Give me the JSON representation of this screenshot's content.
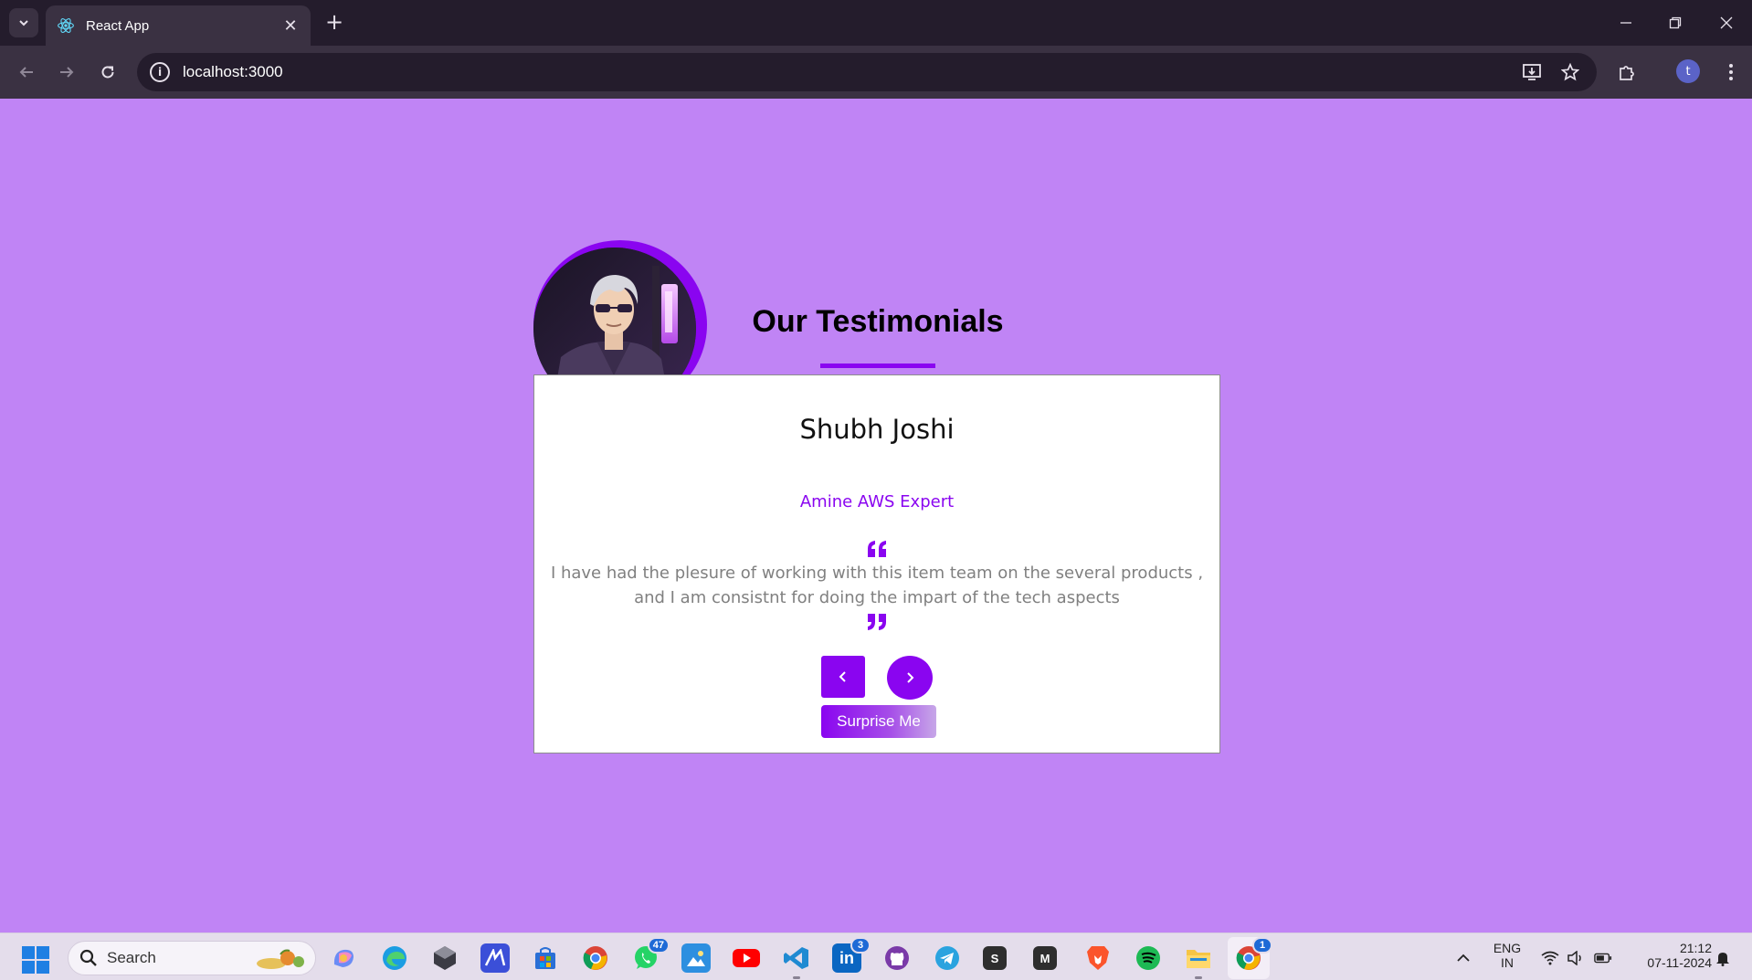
{
  "browser": {
    "tab_title": "React App",
    "url": "localhost:3000",
    "profile_initial": "t"
  },
  "page": {
    "heading": "Our Testimonials",
    "accent_color": "#8a05f0",
    "background_color": "#c084f5",
    "testimonial": {
      "name": "Shubh Joshi",
      "role": "Amine AWS Expert",
      "text": "I have had the plesure of working with this item team on the several products , and I am consistnt for doing the impart of the tech aspects"
    },
    "buttons": {
      "prev_icon": "chevron-left-icon",
      "next_icon": "chevron-right-icon",
      "surprise_label": "Surprise Me"
    }
  },
  "taskbar": {
    "search_label": "Search",
    "badges": {
      "whatsapp": "47",
      "linkedin": "3",
      "chrome": "1"
    },
    "language_line1": "ENG",
    "language_line2": "IN",
    "time": "21:12",
    "date": "07-11-2024",
    "apps": [
      "copilot",
      "edge",
      "app-3d",
      "microsoft-app",
      "store",
      "chrome",
      "whatsapp",
      "photos",
      "youtube",
      "vscode",
      "linkedin",
      "github",
      "telegram",
      "s-app",
      "m-app",
      "brave",
      "spotify",
      "file-explorer",
      "chrome-active"
    ]
  }
}
